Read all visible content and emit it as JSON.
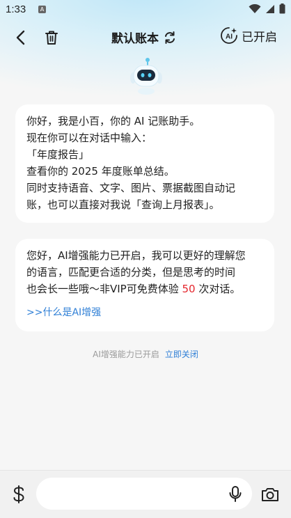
{
  "status_bar": {
    "time": "1:33",
    "app_badge": "A"
  },
  "header": {
    "title": "默认账本",
    "ai_badge": "AI",
    "ai_status": "已开启"
  },
  "messages": [
    {
      "lines": [
        "你好，我是小百，你的 AI 记账助手。",
        "现在你可以在对话中输入：",
        "「年度报告」",
        "查看你的 2025 年度账单总结。",
        "同时支持语音、文字、图片、票据截图自动记",
        "账，也可以直接对我说「查询上月报表」。"
      ]
    },
    {
      "line1": "您好，AI增强能力已开启，我可以更好的理解您",
      "line2": "的语言，匹配更合适的分类，但是思考的时间",
      "line3_pre": "也会长一些哦～非VIP可免费体验 ",
      "free_count": "50",
      "line3_post": " 次对话。",
      "link": ">>什么是AI增强"
    }
  ],
  "notice": {
    "text": "AI增强能力已开启",
    "action": "立即关闭"
  },
  "input": {
    "placeholder": "",
    "value": ""
  },
  "colors": {
    "accent_blue": "#2f7fd6",
    "highlight_red": "#e5262d",
    "header_gradient": "#bfe6f7"
  }
}
